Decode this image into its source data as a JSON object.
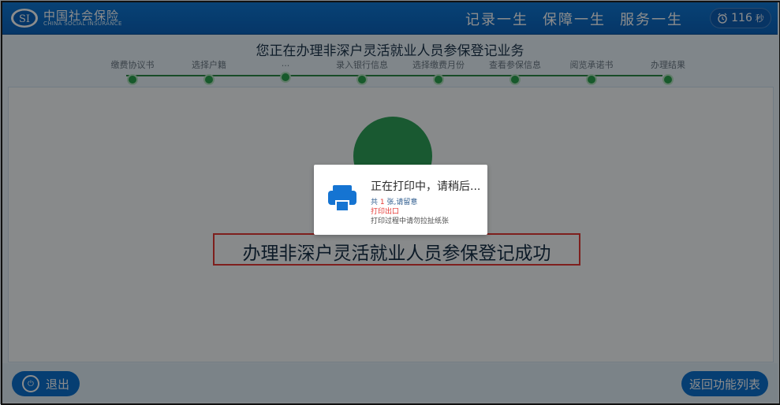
{
  "header": {
    "logo_cn": "中国社会保险",
    "logo_en": "CHINA SOCIAL INSURANCE",
    "slogans": [
      "记录一生",
      "保障一生",
      "服务一生"
    ],
    "timer_value": "116",
    "timer_unit": "秒",
    "timer_icon": "alarm-clock-icon"
  },
  "progress": {
    "title": "您正在办理非深户灵活就业人员参保登记业务",
    "steps": [
      "缴费协议书",
      "选择户籍",
      "...",
      "录入银行信息",
      "选择缴费月份",
      "查看参保信息",
      "阅览承诺书",
      "办理结果"
    ]
  },
  "main": {
    "success_text": "办理非深户灵活就业人员参保登记成功"
  },
  "dialog": {
    "title": "正在打印中，请稍后...",
    "count_prefix": "共",
    "count_value": "1",
    "count_suffix": "张,请留意",
    "output_text": "打印出口",
    "tip_text": "打印过程中请勿拉扯纸张",
    "icon": "printer-icon"
  },
  "footer": {
    "exit_label": "退出",
    "back_label": "返回功能列表",
    "exit_icon": "power-icon"
  },
  "colors": {
    "primary_blue": "#0c72cf",
    "success_green": "#2ea35a",
    "highlight_red": "#e53935"
  }
}
